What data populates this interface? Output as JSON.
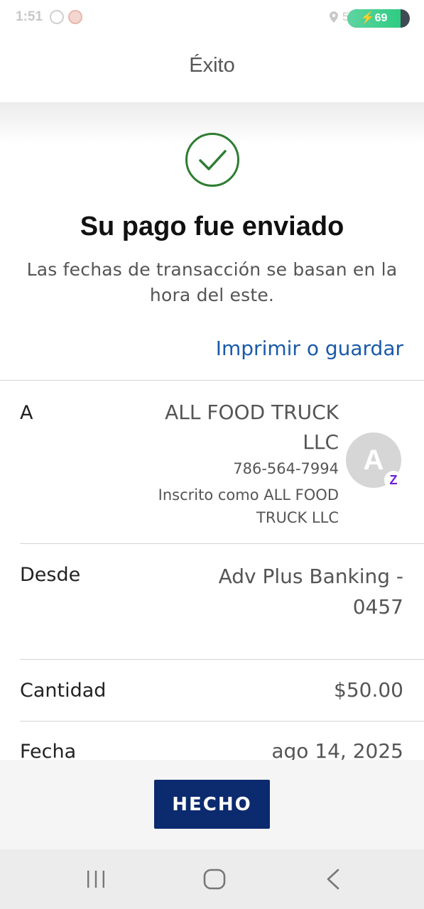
{
  "status_bar": {
    "time": "1:51",
    "partial_text": "5",
    "battery": {
      "level": "69",
      "fraction": 0.85
    },
    "icons": [
      "whatsapp-icon",
      "app-notification-icon",
      "location-icon",
      "charging-icon"
    ]
  },
  "header": {
    "title": "Éxito"
  },
  "confirmation": {
    "icon": "check-circle-icon",
    "title": "Su pago fue enviado",
    "subtitle": "Las fechas de transacción se basan en la hora del este.",
    "print_link": "Imprimir o guardar"
  },
  "details": {
    "to": {
      "label": "A",
      "name": "ALL FOOD TRUCK LLC",
      "phone": "786-564-7994",
      "enrolled": "Inscrito como ALL FOOD TRUCK LLC",
      "avatar_letter": "A",
      "badge": "Z"
    },
    "from": {
      "label": "Desde",
      "value": "Adv Plus Banking - 0457"
    },
    "amount": {
      "label": "Cantidad",
      "value": "$50.00"
    },
    "date": {
      "label": "Fecha",
      "value": "ago 14, 2025"
    }
  },
  "actions": {
    "done_label": "HECHO"
  },
  "navigation": {
    "buttons": [
      "recents-icon",
      "home-icon",
      "back-icon"
    ]
  },
  "colors": {
    "accent_link": "#1a5aa8",
    "success": "#2e7d32",
    "button_bg": "#0c2a6e",
    "zelle_purple": "#6d1ed4"
  }
}
